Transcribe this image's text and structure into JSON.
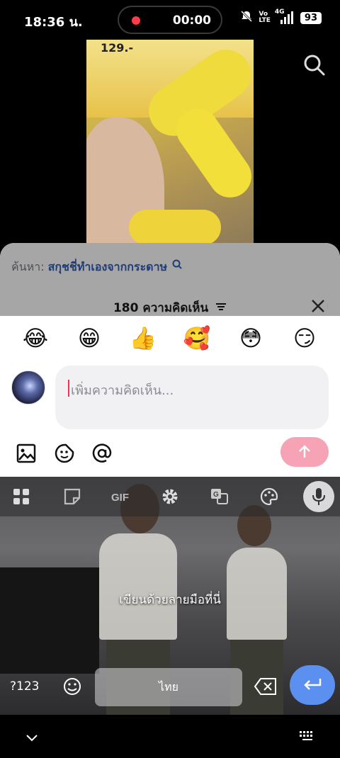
{
  "status_bar": {
    "time": "18:36 น.",
    "recording_time": "00:00",
    "volte_top": "Vo",
    "volte_bottom": "LTE",
    "network": "4G",
    "battery": "93"
  },
  "comments": {
    "related_label": "ค้นหา:",
    "related_term": "สกุชชี่ทำเองจากกระดาษ",
    "count_text": "180 ความคิดเห็น",
    "emojis": [
      "😂",
      "😁",
      "👍",
      "🥰",
      "😳",
      "😏"
    ],
    "input_placeholder": "เพิ่มความคิดเห็น..."
  },
  "keyboard": {
    "symbols_key": "?123",
    "space_label": "ไทย",
    "handwriting_hint": "เขียนด้วยลายมือที่นี่"
  },
  "video": {
    "price_text": "129.-"
  },
  "colors": {
    "send_button": "#f5a3b5",
    "enter_key": "#5b8ff0",
    "caret": "#e8335a",
    "search_term": "#1f3c7a"
  }
}
